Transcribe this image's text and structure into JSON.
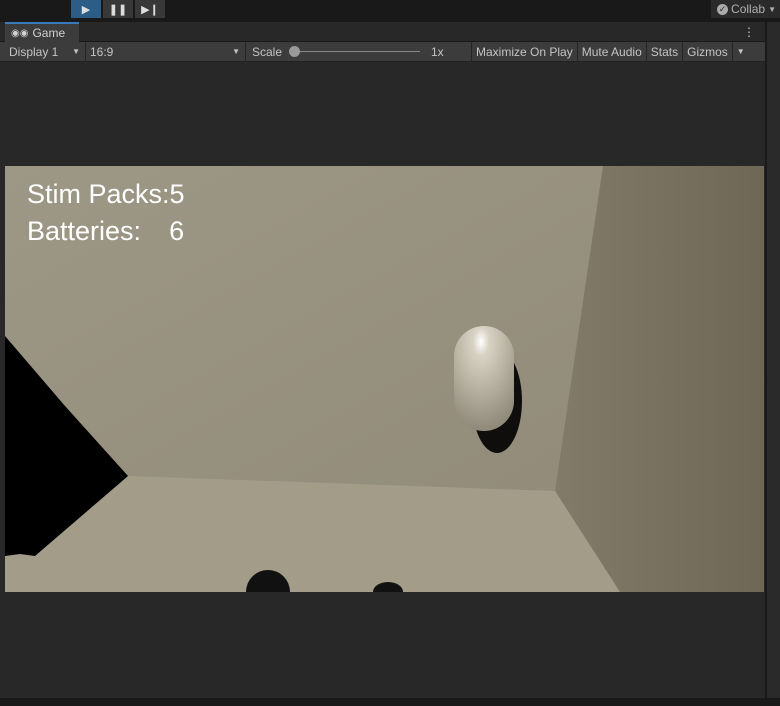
{
  "toolbar": {
    "play": "▶",
    "pause": "❚❚",
    "step": "▶❙",
    "collab": "Collab"
  },
  "tab": {
    "label": "Game",
    "icon": "gamepad-icon"
  },
  "game_toolbar": {
    "display": "Display 1",
    "aspect": "16:9",
    "scale_label": "Scale",
    "scale_value": "1x",
    "scale_level": 0,
    "maximize": "Maximize On Play",
    "mute": "Mute Audio",
    "stats": "Stats",
    "gizmos": "Gizmos"
  },
  "hud": {
    "stim_packs": "Stim Packs:5",
    "batteries_label": "Batteries:",
    "batteries_value": "6"
  },
  "colors": {
    "accent": "#2c5d87",
    "wall": "#9a9483",
    "floor": "#a29c88"
  }
}
